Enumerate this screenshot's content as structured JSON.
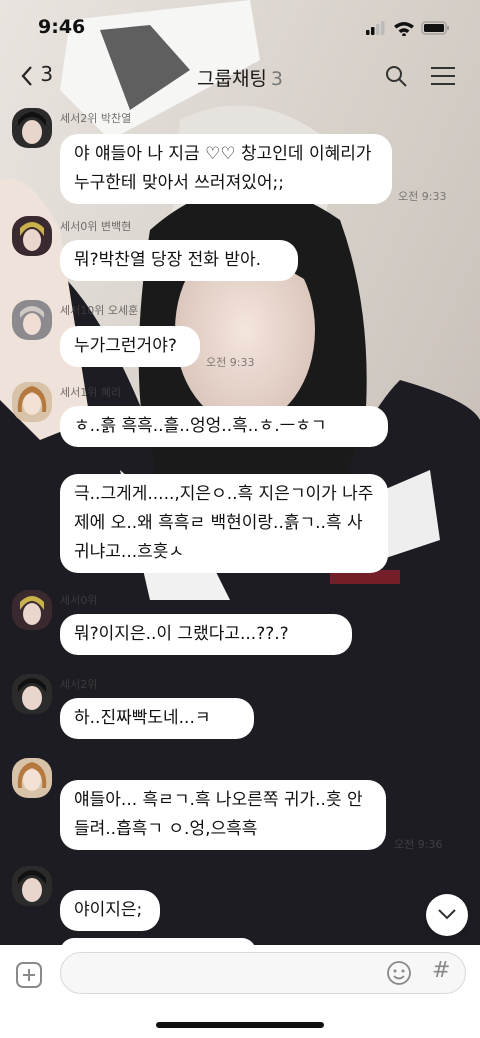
{
  "status_bar": {
    "time": "9:46"
  },
  "header": {
    "back_count": "3",
    "title": "그룹채팅",
    "member_count": "3"
  },
  "messages": [
    {
      "sender": "세서2위 박찬열",
      "text": "야 얘들아 나 지금 ♡♡ 창고인데 이혜리가 누구한테 맞아서 쓰러져있어;;",
      "time": "오전 9:33"
    },
    {
      "sender": "세서0위 변백현",
      "text": "뭐?박찬열 당장 전화 받아."
    },
    {
      "sender": "세서10위 오세훈",
      "text": "누가그런거야?",
      "time": "오전 9:33"
    },
    {
      "sender": "세서1위 혜리",
      "text": "ㅎ..흙 흑흑..흘..엉엉..흑..ㅎ.ㅡㅎㄱ"
    },
    {
      "text": "극..그게게.....,지은ㅇ..흑 지은ㄱ이가 나주제에 오..왜 흑흑ㄹ 백현이랑..흙ㄱ..흑 사귀냐고...흐흣ㅅ"
    },
    {
      "sender": "세서0위",
      "text": "뭐?이지은..이 그랬다고...??.?"
    },
    {
      "sender": "세서2위",
      "text": "하..진짜빡도네...ㅋ"
    },
    {
      "text": "얘들아... 흑ㄹㄱ.흑 나오른쪽 귀가..흣 안들려..흡흑ㄱ ㅇ.엉,으흑흑",
      "time": "오전 9:36"
    },
    {
      "text": "야이지은;"
    }
  ],
  "composer": {
    "placeholder": ""
  },
  "icons": [
    "back-chevron-icon",
    "search-icon",
    "menu-icon",
    "chevron-down-icon",
    "plus-icon",
    "emoji-icon",
    "hash-icon"
  ]
}
